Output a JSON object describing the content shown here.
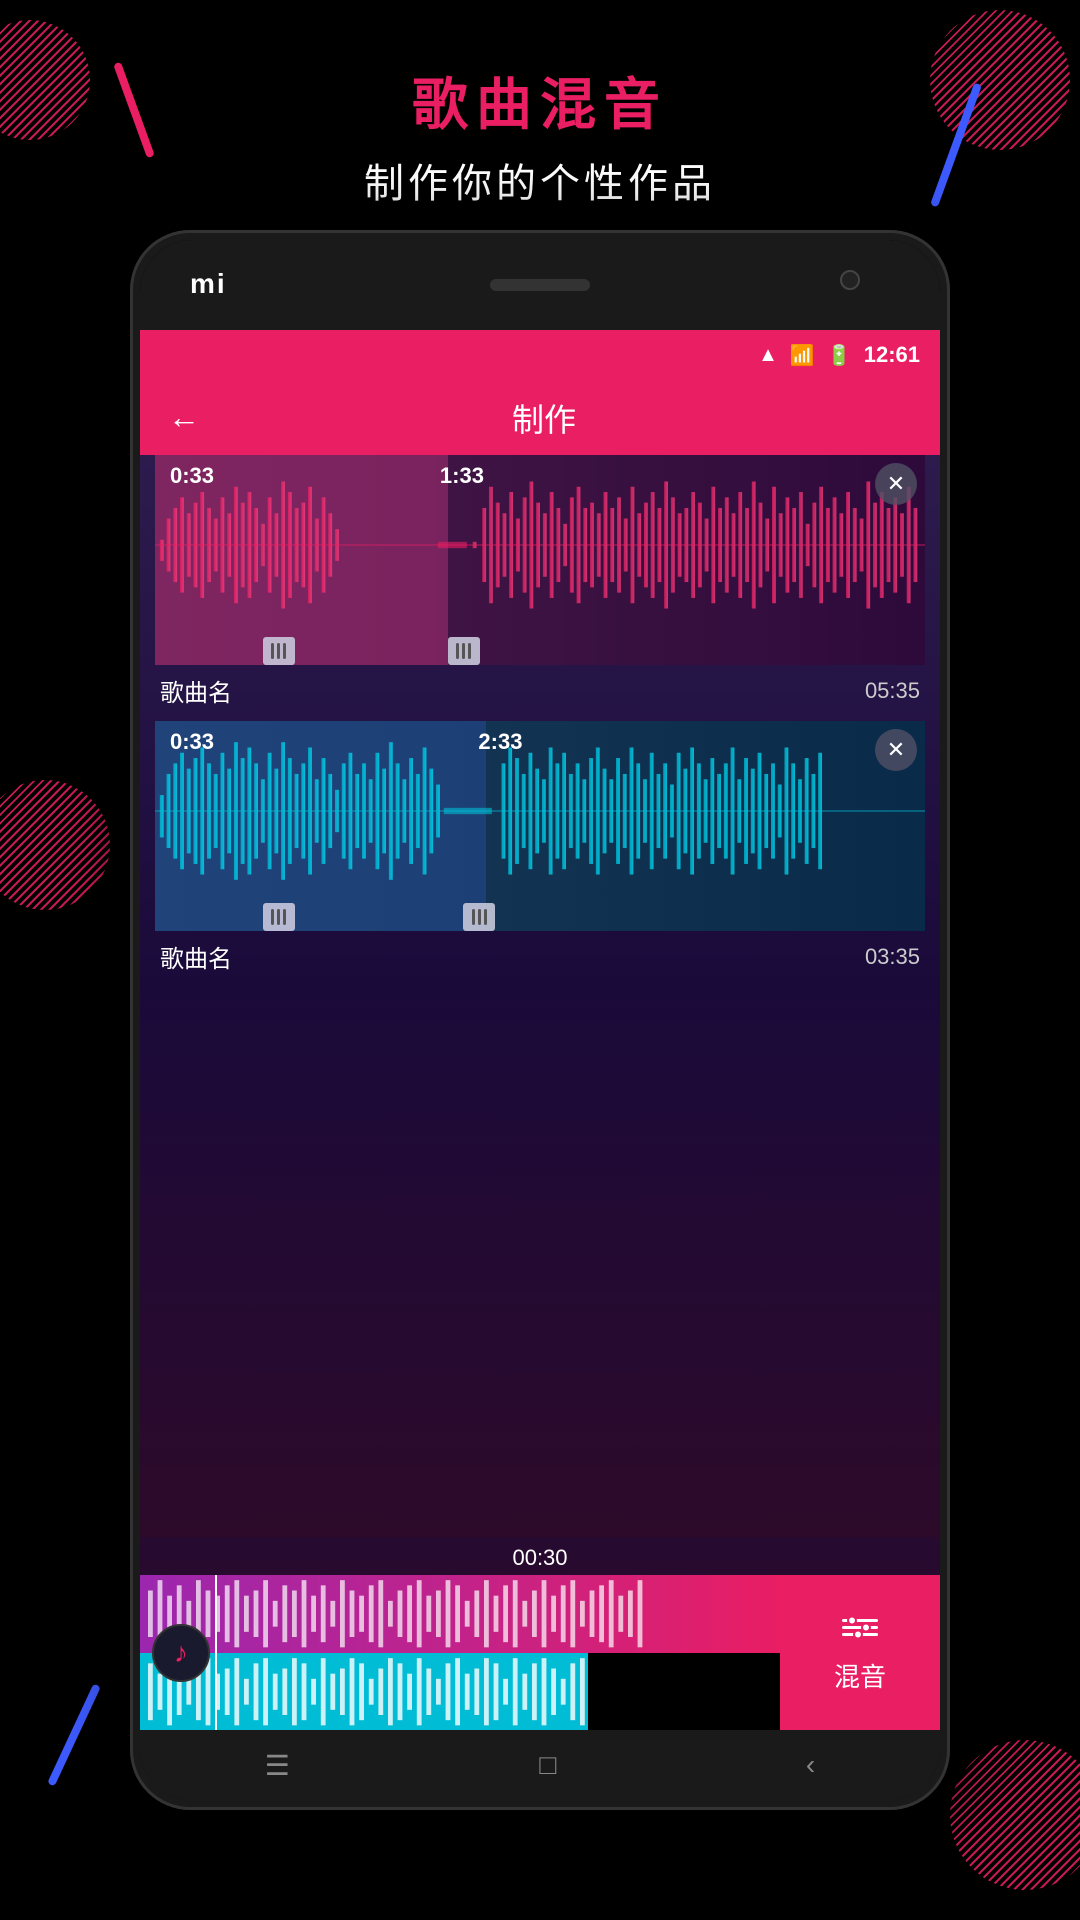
{
  "page": {
    "title_main": "歌曲混音",
    "title_sub": "制作你的个性作品",
    "mi_logo": "mi"
  },
  "status_bar": {
    "time": "12:61",
    "wifi_icon": "wifi",
    "signal_icon": "signal",
    "battery_icon": "battery"
  },
  "top_bar": {
    "back_label": "←",
    "title": "制作"
  },
  "track1": {
    "time_start": "0:33",
    "time_end": "1:33",
    "name": "歌曲名",
    "duration": "05:35",
    "color": "#e91e63"
  },
  "track2": {
    "time_start": "0:33",
    "time_end": "2:33",
    "name": "歌曲名",
    "duration": "03:35",
    "color": "#00bcd4"
  },
  "playback": {
    "current_time": "00:30"
  },
  "mix_button": {
    "icon": "≡",
    "label": "混音"
  },
  "bottom_nav": {
    "menu_icon": "☰",
    "home_icon": "□",
    "back_icon": "‹"
  }
}
